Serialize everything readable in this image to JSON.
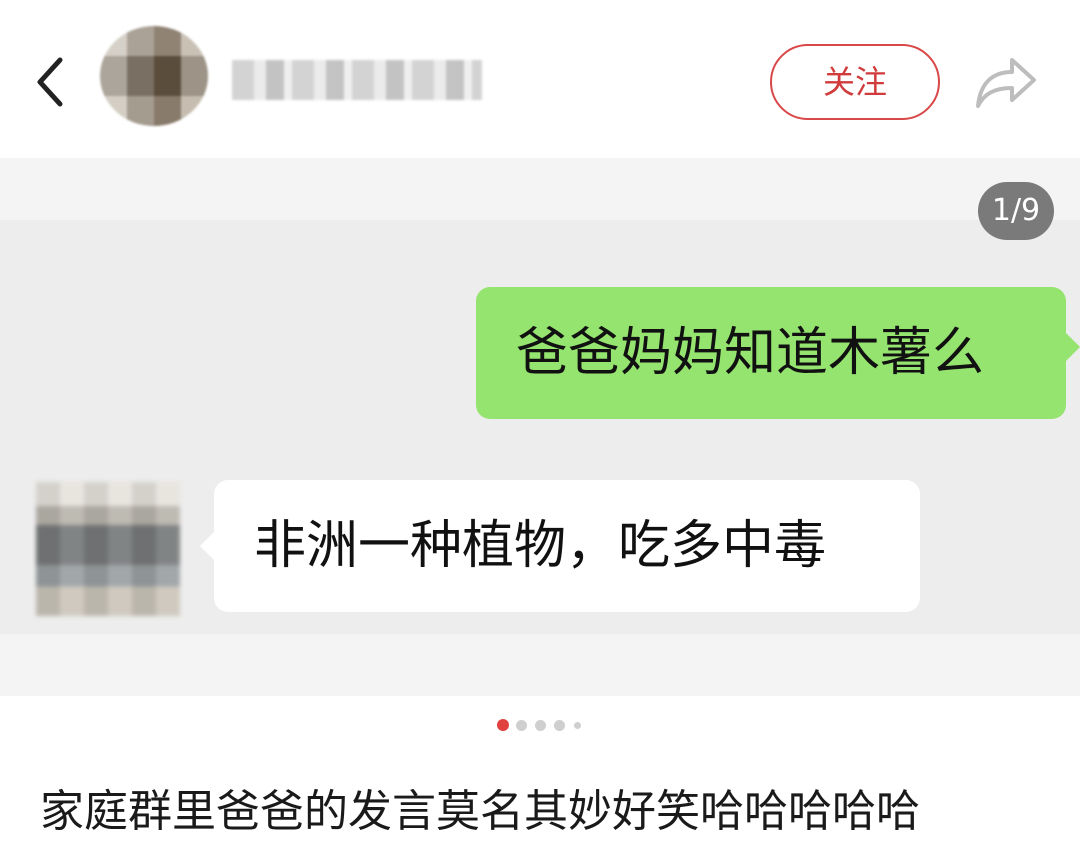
{
  "header": {
    "back_icon": "chevron-left-icon",
    "follow_label": "关注",
    "share_icon": "share-arrow-icon"
  },
  "viewer": {
    "counter": "1/9",
    "messages": [
      {
        "side": "right",
        "text": "爸爸妈妈知道木薯么"
      },
      {
        "side": "left",
        "text": "非洲一种植物，吃多中毒"
      }
    ],
    "colors": {
      "outgoing_bubble": "#95e46f",
      "incoming_bubble": "#ffffff",
      "accent": "#d94848"
    }
  },
  "pagination": {
    "total_visible_dots": 5,
    "active_index": 0
  },
  "caption": "家庭群里爸爸的发言莫名其妙好笑哈哈哈哈哈"
}
